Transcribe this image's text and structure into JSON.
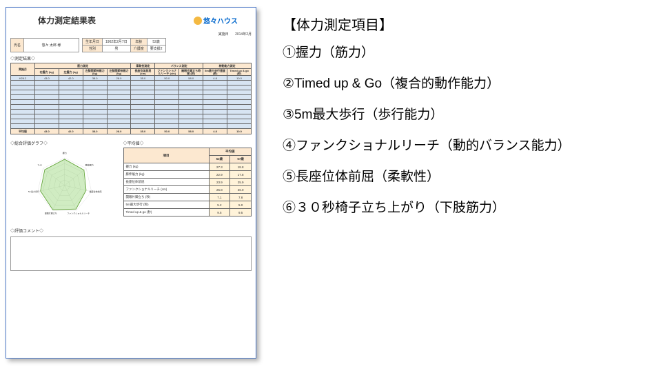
{
  "sheet": {
    "title": "体力測定結果表",
    "brand": "悠々ハウス",
    "exec_date_label": "実施日",
    "exec_date_value": "2014年2月",
    "name_label": "氏名",
    "name_value": "悠々 太郎  様",
    "birth_label": "生年月日",
    "birth_value": "1962年2月7日",
    "age_label": "年齢",
    "age_value": "52歳",
    "sex_label": "性別",
    "sex_value": "男",
    "care_label": "介護度",
    "care_value": "要支援2",
    "result_sec": "◇測定結果◇",
    "radar_sec": "◇総合評価グラフ◇",
    "avg_sec": "◇平均値◇",
    "comment_sec": "◇評価コメント◇",
    "groups": [
      "",
      "筋力測定",
      "",
      "柔軟性測定",
      "バランス測定",
      "",
      "移動能力測定"
    ],
    "headers": [
      "実施月",
      "右握力 (kg)",
      "左握力 (kg)",
      "左膝関節伸展力 (kg)",
      "左膝関節伸展力 (kg)",
      "長座位体前屈 (cm)",
      "ファンクショナルリーチ (cm)",
      "開眼片脚立ち時間 (秒)",
      "5m最大歩行速度 (秒)",
      "Timed up & go (秒)"
    ],
    "row1_label": "H26.2",
    "row1": [
      "43.0",
      "42.0",
      "38.0",
      "28.0",
      "35.0",
      "50.0",
      "58.0",
      "4.8",
      "10.0"
    ],
    "avg_label": "平均値",
    "avg_row": [
      "43.0",
      "42.0",
      "38.0",
      "28.0",
      "35.0",
      "50.0",
      "58.0",
      "4.8",
      "10.0"
    ],
    "avg_tbl_hdr_item": "項目",
    "avg_tbl_hdr_val": "平均値",
    "avg_tbl_sub1": "52歳",
    "avg_tbl_sub2": "57歳",
    "avg_rows": [
      {
        "label": "握力 (kg)",
        "v1": "27.3",
        "v2": "18.8"
      },
      {
        "label": "膝伸展力 (kg)",
        "v1": "22.9",
        "v2": "17.8"
      },
      {
        "label": "長座位体前屈",
        "v1": "23.9",
        "v2": "25.9"
      },
      {
        "label": "ファンクショナルリーチ (cm)",
        "v1": "25.8",
        "v2": "26.0"
      },
      {
        "label": "開眼片脚立ち (秒)",
        "v1": "7.1",
        "v2": "7.8"
      },
      {
        "label": "5m最大歩行 (秒)",
        "v1": "5.2",
        "v2": "5.0"
      },
      {
        "label": "Timed up & go (秒)",
        "v1": "9.5",
        "v2": "9.5"
      }
    ],
    "radar_labels": [
      "握力",
      "膝伸展力",
      "長座位体前屈",
      "ファンクショナルリーチ",
      "開眼片脚立ち",
      "5m最大歩行",
      "TUG"
    ]
  },
  "chart_data": {
    "type": "radar",
    "categories": [
      "握力",
      "膝伸展力",
      "長座位体前屈",
      "ファンクショナルリーチ",
      "開眼片脚立ち",
      "5m最大歩行",
      "TUG"
    ],
    "series": [
      {
        "name": "H26.2",
        "values": [
          95,
          90,
          80,
          95,
          98,
          90,
          92
        ]
      }
    ],
    "max": 100
  },
  "items": {
    "title": "【体力測定項目】",
    "list": [
      "①握力（筋力）",
      "②Timed up & Go（複合的動作能力）",
      "③5m最大歩行（歩行能力）",
      "④ファンクショナルリーチ（動的バランス能力）",
      "⑤長座位体前屈（柔軟性）",
      "⑥３０秒椅子立ち上がり（下肢筋力）"
    ]
  }
}
